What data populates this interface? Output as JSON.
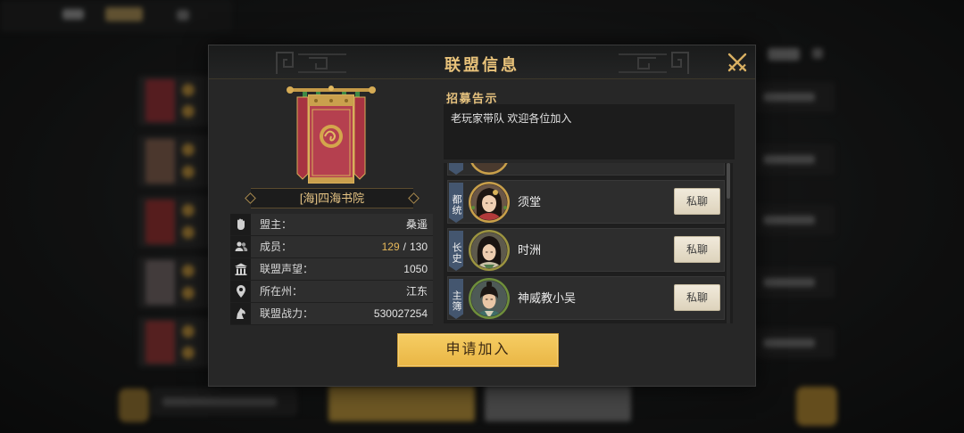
{
  "dialog": {
    "title": "联盟信息"
  },
  "alliance": {
    "tag": "[海]",
    "name": "四海书院"
  },
  "info": {
    "leader": {
      "label": "盟主：",
      "value": "桑遥"
    },
    "members": {
      "label": "成员：",
      "current": "129",
      "separator": "/",
      "max": "130"
    },
    "reputation": {
      "label": "联盟声望：",
      "value": "1050"
    },
    "region": {
      "label": "所在州：",
      "value": "江东"
    },
    "power": {
      "label": "联盟战力：",
      "value": "530027254"
    }
  },
  "recruit": {
    "label": "招募告示",
    "text": "老玩家带队 欢迎各位加入"
  },
  "officers": [
    {
      "role": "都统",
      "name": "须堂",
      "chat_label": "私聊"
    },
    {
      "role": "长史",
      "name": "时洲",
      "chat_label": "私聊"
    },
    {
      "role": "主簿",
      "name": "神威教小吴",
      "chat_label": "私聊"
    }
  ],
  "actions": {
    "apply_label": "申请加入"
  },
  "icons": {
    "close": "crossed-swords-close-icon",
    "leader": "fist-icon",
    "members": "people-icon",
    "reputation": "gate-icon",
    "region": "location-pin-icon",
    "power": "horse-icon",
    "banner": "alliance-banner"
  },
  "colors": {
    "accent_gold": "#e6c27e",
    "member_count_highlight": "#e8b95a",
    "apply_button": "#f1c052",
    "role_tag": "#44566f",
    "chat_button": "#e9e1cd"
  }
}
